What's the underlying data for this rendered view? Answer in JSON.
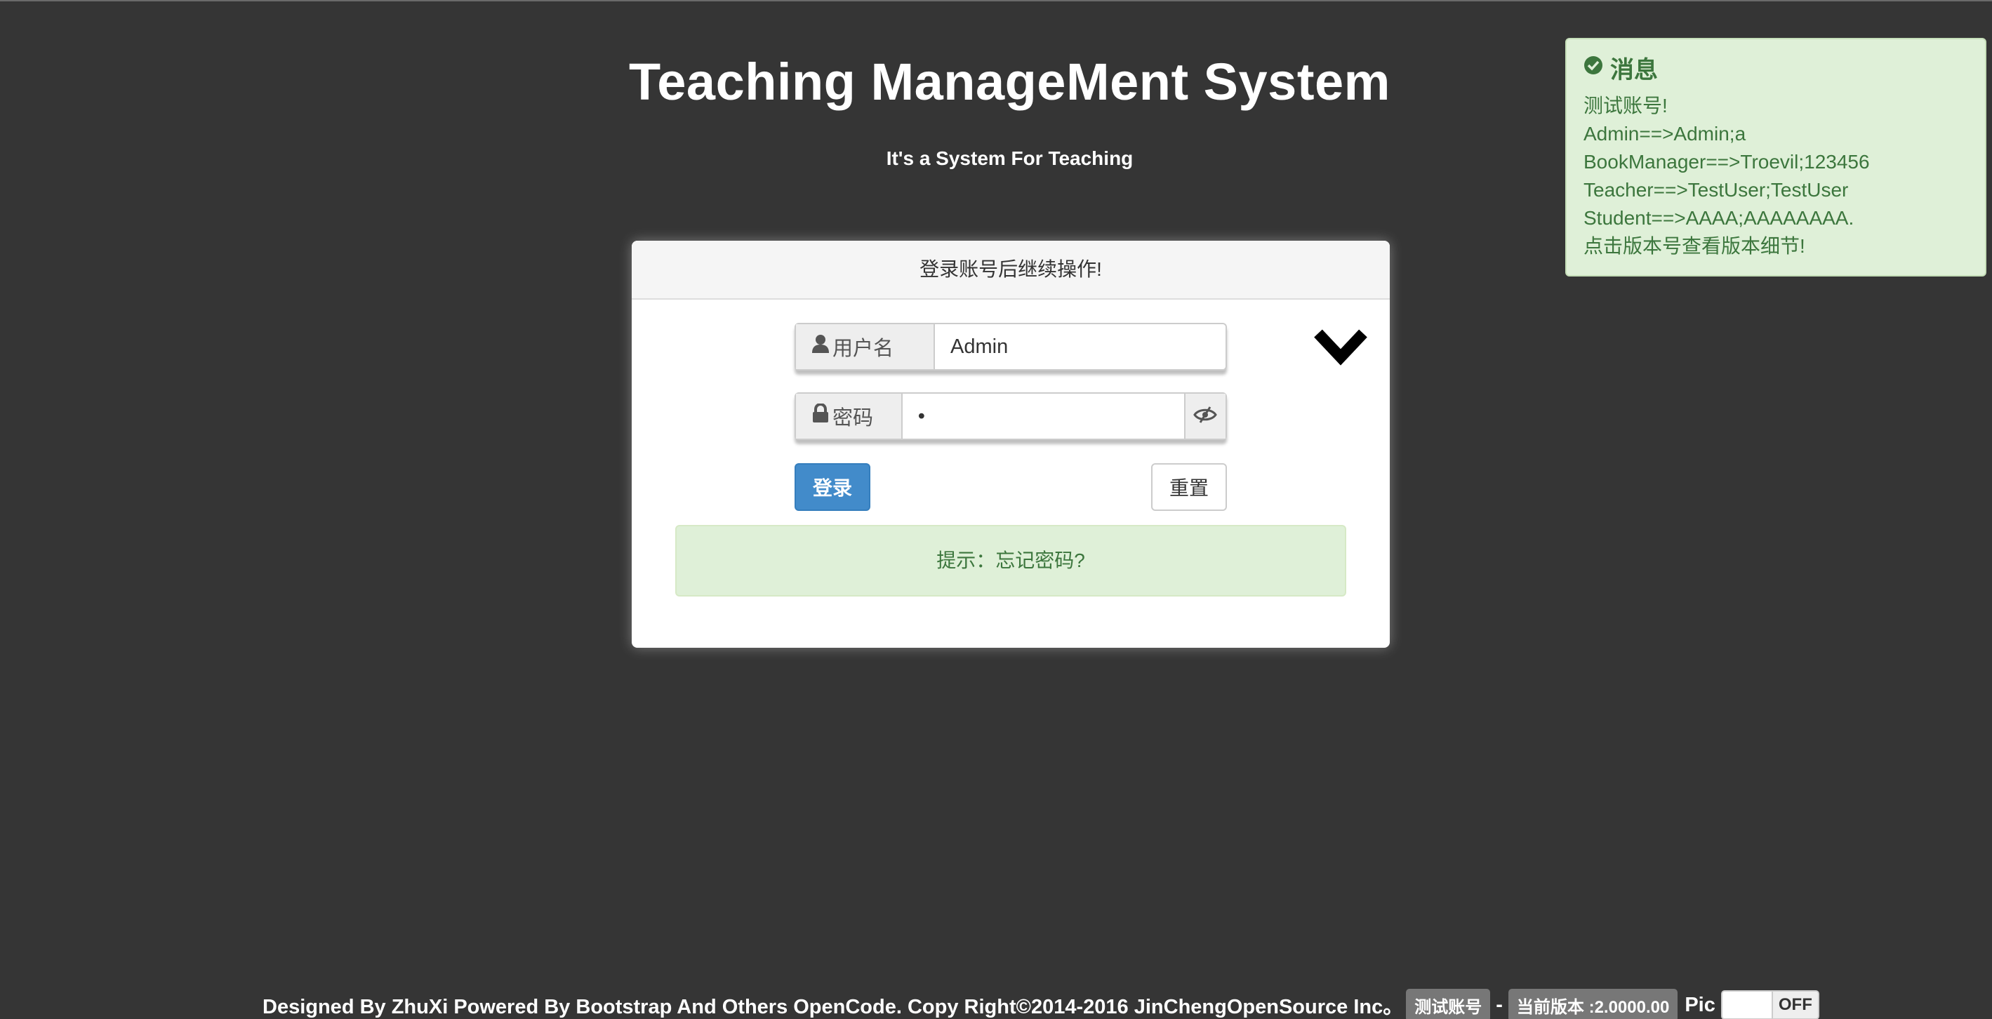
{
  "header": {
    "title": "Teaching ManageMent System",
    "subtitle": "It's a System For Teaching"
  },
  "login": {
    "panel_heading": "登录账号后继续操作!",
    "username_label": "用户名",
    "username_value": "Admin",
    "password_label": "密码",
    "password_value": "•",
    "login_button": "登录",
    "reset_button": "重置",
    "hint": "提示：忘记密码?"
  },
  "toast": {
    "title": "消息",
    "lines": [
      "测试账号!",
      "Admin==>Admin;a",
      "BookManager==>Troevil;123456",
      "Teacher==>TestUser;TestUser",
      "Student==>AAAA;AAAAAAAA.",
      "点击版本号查看版本细节!"
    ]
  },
  "footer": {
    "credits": "Designed By ZhuXi Powered By Bootstrap And Others OpenCode. Copy Right©2014-2016 JinChengOpenSource Inc。",
    "test_accounts_badge": "测试账号",
    "separator": "-",
    "version_badge": "当前版本 :2.0000.00",
    "pic_label": "Pic",
    "pic_toggle_state": "OFF"
  },
  "colors": {
    "background": "#353535",
    "primary": "#428bca",
    "success_bg": "#dff0d8",
    "success_text": "#3c763d"
  }
}
